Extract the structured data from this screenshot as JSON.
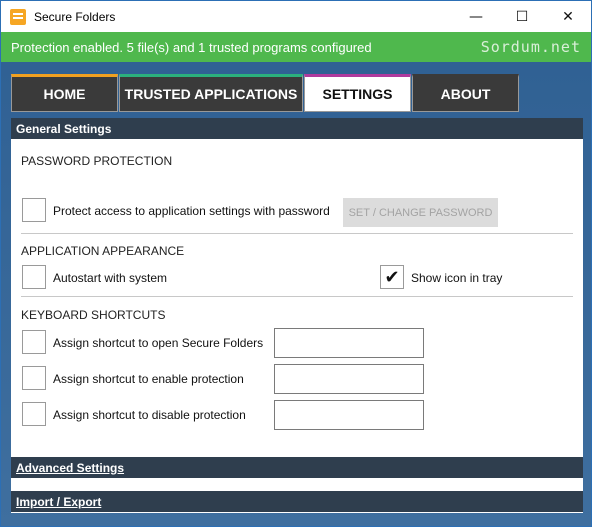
{
  "window": {
    "title": "Secure Folders",
    "controls": {
      "minimize": "—",
      "maximize": "☐",
      "close": "✕"
    }
  },
  "status": {
    "text": "Protection enabled. 5 file(s) and 1 trusted programs configured",
    "brand": "Sordum.net"
  },
  "tabs": [
    {
      "label": "HOME",
      "active": false
    },
    {
      "label": "TRUSTED APPLICATIONS",
      "active": false
    },
    {
      "label": "SETTINGS",
      "active": true
    },
    {
      "label": "ABOUT",
      "active": false
    }
  ],
  "sections": {
    "general": "General Settings",
    "advanced": "Advanced Settings",
    "import_export": "Import / Export"
  },
  "password": {
    "title": "PASSWORD PROTECTION",
    "checkbox_label": "Protect access to application settings with password",
    "checked": false,
    "button": "SET / CHANGE PASSWORD"
  },
  "appearance": {
    "title": "APPLICATION APPEARANCE",
    "autostart_label": "Autostart with system",
    "autostart_checked": false,
    "tray_label": "Show icon in tray",
    "tray_checked": true,
    "check_glyph": "✔"
  },
  "shortcuts": {
    "title": "KEYBOARD SHORTCUTS",
    "items": [
      {
        "label": "Assign shortcut to open Secure Folders",
        "value": ""
      },
      {
        "label": "Assign shortcut to enable protection",
        "value": ""
      },
      {
        "label": "Assign shortcut to disable protection",
        "value": ""
      }
    ]
  },
  "colors": {
    "status_green": "#4fb84d",
    "section_header": "#2f3e4e",
    "tab_dark": "#3a3a3a",
    "tab_home_accent": "#f0a020",
    "tab_trusted_accent": "#2bb07d",
    "tab_settings_accent": "#b03a9e"
  }
}
